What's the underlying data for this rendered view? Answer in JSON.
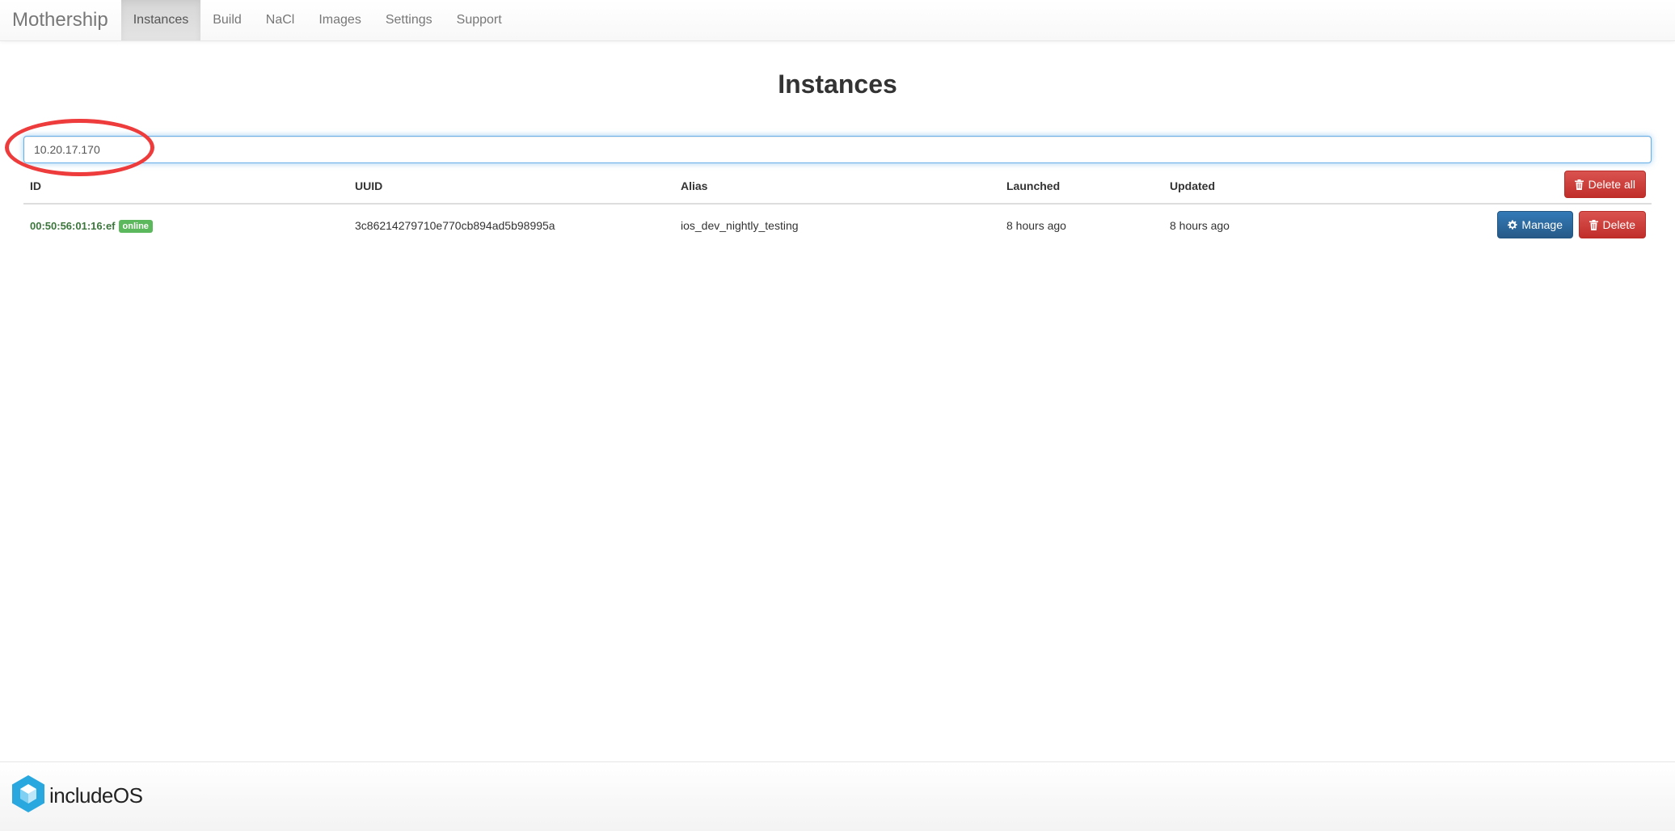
{
  "navbar": {
    "brand": "Mothership",
    "items": [
      {
        "label": "Instances",
        "active": true
      },
      {
        "label": "Build"
      },
      {
        "label": "NaCl"
      },
      {
        "label": "Images"
      },
      {
        "label": "Settings"
      },
      {
        "label": "Support"
      }
    ]
  },
  "page": {
    "title": "Instances"
  },
  "search": {
    "value": "10.20.17.170"
  },
  "table": {
    "headers": {
      "id": "ID",
      "uuid": "UUID",
      "alias": "Alias",
      "launched": "Launched",
      "updated": "Updated"
    },
    "delete_all_label": "Delete all",
    "rows": [
      {
        "id": "00:50:56:01:16:ef",
        "status": "online",
        "uuid": "3c86214279710e770cb894ad5b98995a",
        "alias": "ios_dev_nightly_testing",
        "launched": "8 hours ago",
        "updated": "8 hours ago",
        "manage_label": "Manage",
        "delete_label": "Delete"
      }
    ]
  },
  "footer": {
    "logo_text": "includeOS"
  },
  "colors": {
    "danger": "#d9534f",
    "primary": "#337ab7",
    "success": "#5cb85c",
    "online_text": "#3c763d",
    "highlight_ring": "#ee3b3b",
    "logo_blue": "#29a8e0"
  },
  "icons": {
    "delete_all": "trash-icon",
    "manage": "gear-icon",
    "delete": "trash-icon",
    "logo": "cube-icon"
  }
}
